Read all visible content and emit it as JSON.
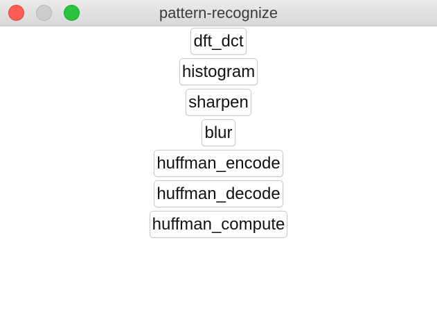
{
  "window": {
    "title": "pattern-recognize"
  },
  "buttons": [
    {
      "label": "dft_dct"
    },
    {
      "label": "histogram"
    },
    {
      "label": "sharpen"
    },
    {
      "label": "blur"
    },
    {
      "label": "huffman_encode"
    },
    {
      "label": "huffman_decode"
    },
    {
      "label": "huffman_compute"
    }
  ],
  "colors": {
    "close": "#fd5c56",
    "minimize": "#cdcdcd",
    "zoom": "#29c33f"
  }
}
